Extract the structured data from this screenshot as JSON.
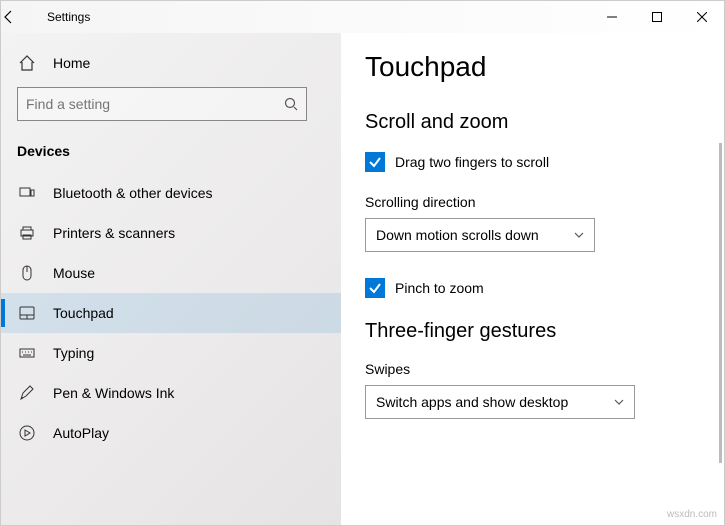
{
  "window": {
    "title": "Settings"
  },
  "sidebar": {
    "home_label": "Home",
    "search_placeholder": "Find a setting",
    "section": "Devices",
    "items": [
      {
        "label": "Bluetooth & other devices"
      },
      {
        "label": "Printers & scanners"
      },
      {
        "label": "Mouse"
      },
      {
        "label": "Touchpad"
      },
      {
        "label": "Typing"
      },
      {
        "label": "Pen & Windows Ink"
      },
      {
        "label": "AutoPlay"
      }
    ]
  },
  "main": {
    "page_title": "Touchpad",
    "section_scroll": "Scroll and zoom",
    "drag_two_fingers": "Drag two fingers to scroll",
    "scroll_dir_label": "Scrolling direction",
    "scroll_dir_value": "Down motion scrolls down",
    "pinch_zoom": "Pinch to zoom",
    "section_three": "Three-finger gestures",
    "swipes_label": "Swipes",
    "swipes_value": "Switch apps and show desktop"
  },
  "watermark": "wsxdn.com"
}
